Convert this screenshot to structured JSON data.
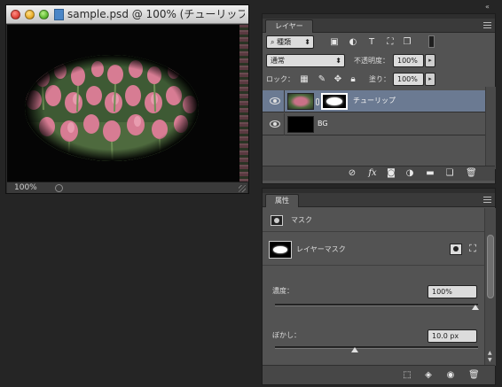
{
  "document_window": {
    "title": "sample.psd @ 100% (チューリップ, ...",
    "zoom_status": "100%",
    "canvas_image": "tulip-field-photo-with-elliptical-feathered-mask"
  },
  "layers_panel": {
    "tab_label": "レイヤー",
    "filter_kind": "種類",
    "blend_mode": "通常",
    "opacity_label": "不透明度：",
    "opacity_value": "100%",
    "lock_label": "ロック：",
    "fill_label": "塗り：",
    "fill_value": "100%",
    "layers": [
      {
        "name": "チューリップ",
        "visible": true,
        "selected": true,
        "has_mask": true
      },
      {
        "name": "BG",
        "visible": true,
        "selected": false,
        "has_mask": false
      }
    ],
    "footer_icons": [
      "link-icon",
      "fx-icon",
      "add-mask-icon",
      "adjustment-icon",
      "group-folder-icon",
      "new-layer-icon",
      "trash-icon"
    ]
  },
  "properties_panel": {
    "tab_label": "属性",
    "section_label": "マスク",
    "mask_label": "レイヤーマスク",
    "density_label": "濃度：",
    "density_value": "100%",
    "density_fraction": 1.0,
    "feather_label": "ぼかし：",
    "feather_value": "10.0 px",
    "feather_fraction": 0.4,
    "footer_icons": [
      "selection-icon",
      "apply-mask-icon",
      "visibility-icon",
      "trash-icon"
    ]
  },
  "colors": {
    "selected_layer": "#6b7a92",
    "panel_bg": "#535353",
    "app_bg": "#252525"
  }
}
